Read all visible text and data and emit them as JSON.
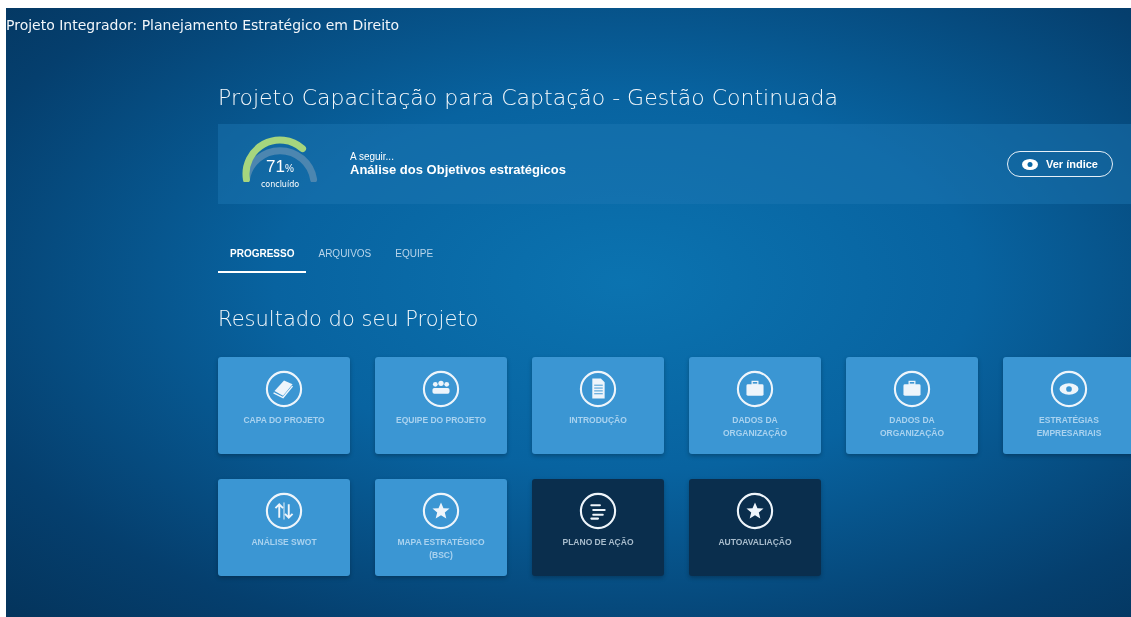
{
  "window": {
    "title": "Projeto Integrador: Planejamento Estratégico em Direito"
  },
  "project": {
    "title": "Projeto Capacitação para Captação - Gestão Continuada"
  },
  "progress": {
    "value": "71",
    "unit": "%",
    "caption": "concluído",
    "next_label": "A seguir...",
    "next_title": "Análise dos Objetivos estratégicos",
    "index_button": "Ver índice"
  },
  "tabs": [
    {
      "label": "PROGRESSO",
      "selected": true
    },
    {
      "label": "ARQUIVOS",
      "selected": false
    },
    {
      "label": "EQUIPE",
      "selected": false
    }
  ],
  "section_title": "Resultado do seu Projeto",
  "cards": [
    {
      "kind": "book",
      "label": "CAPA DO PROJETO",
      "completed": true
    },
    {
      "kind": "team",
      "label": "EQUIPE DO PROJETO",
      "completed": true
    },
    {
      "kind": "document",
      "label": "INTRODUÇÃO",
      "completed": true
    },
    {
      "kind": "briefcase",
      "label": "DADOS DA ORGANIZAÇÃO",
      "completed": true
    },
    {
      "kind": "briefcase",
      "label": "DADOS DA ORGANIZAÇÃO",
      "completed": true
    },
    {
      "kind": "eye",
      "label": "ESTRATÉGIAS EMPRESARIAIS",
      "completed": true
    },
    {
      "kind": "swap",
      "label": "ANÁLISE SWOT",
      "completed": true
    },
    {
      "kind": "star",
      "label": "MAPA ESTRATÉGICO (BSC)",
      "completed": true
    },
    {
      "kind": "list",
      "label": "PLANO DE AÇÃO",
      "completed": false
    },
    {
      "kind": "star",
      "label": "AUTOAVALIAÇÃO",
      "completed": false
    }
  ]
}
